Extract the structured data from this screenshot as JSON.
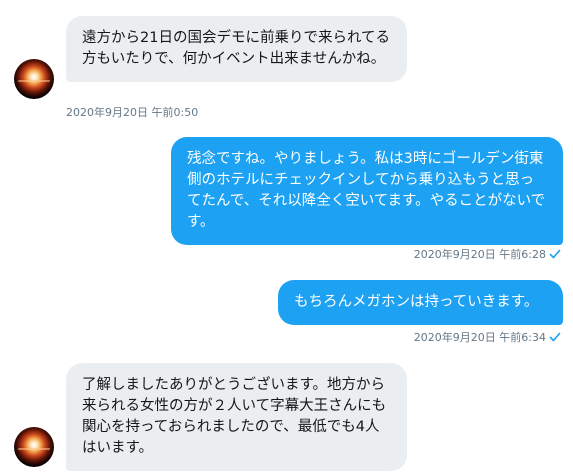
{
  "messages": [
    {
      "direction": "incoming",
      "text": "遠方から21日の国会デモに前乗りで来られてる方もいたりで、何かイベント出来ませんかね。",
      "timestamp": "2020年9月20日 午前0:50"
    },
    {
      "direction": "outgoing",
      "text": "残念ですね。やりましょう。私は3時にゴールデン街東側のホテルにチェックインしてから乗り込もうと思ってたんで、それ以降全く空いてます。やることがないです。",
      "timestamp": "2020年9月20日 午前6:28",
      "status_icon": "read-check-icon"
    },
    {
      "direction": "outgoing",
      "text": "もちろんメガホンは持っていきます。",
      "timestamp": "2020年9月20日 午前6:34",
      "status_icon": "read-check-icon"
    },
    {
      "direction": "incoming",
      "text": "了解しましたありがとうございます。地方から来られる女性の方が２人いて字幕大王さんにも関心を持っておられましたので、最低でも4人はいます。"
    }
  ],
  "colors": {
    "incoming_bubble": "#ebeef0",
    "outgoing_bubble": "#1da1f2",
    "timestamp": "#657786",
    "check": "#1da1f2"
  }
}
